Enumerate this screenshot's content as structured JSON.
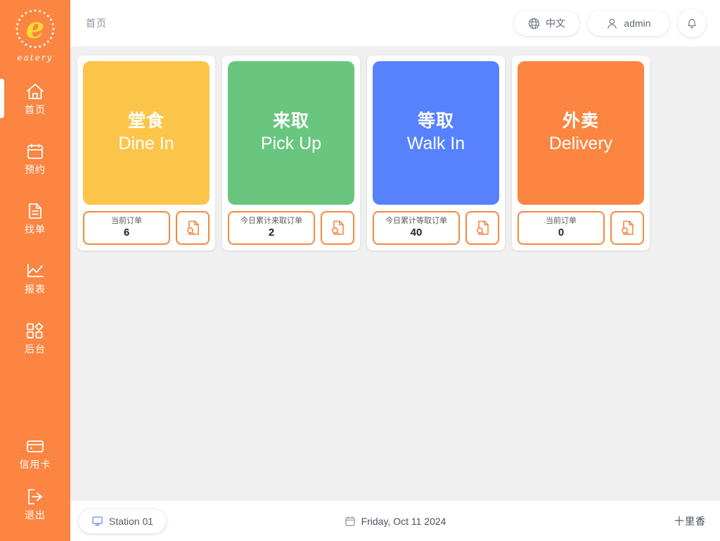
{
  "brand": {
    "logo_letter": "e",
    "logo_word": "eatery",
    "logo_letter_color": "#FBD832",
    "sidebar_color": "#FB8541"
  },
  "sidebar": {
    "items": [
      {
        "label": "首页",
        "icon": "home-icon",
        "active": true
      },
      {
        "label": "预约",
        "icon": "calendar-icon",
        "active": false
      },
      {
        "label": "找单",
        "icon": "document-icon",
        "active": false
      },
      {
        "label": "报表",
        "icon": "chart-line-icon",
        "active": false
      },
      {
        "label": "后台",
        "icon": "dashboard-squares-icon",
        "active": false
      }
    ],
    "bottom_items": [
      {
        "label": "信用卡",
        "icon": "credit-card-icon"
      },
      {
        "label": "退出",
        "icon": "logout-icon"
      }
    ]
  },
  "header": {
    "breadcrumb": "首页",
    "language_label": "中文",
    "language_icon": "globe-icon",
    "user_label": "admin",
    "user_icon": "user-icon",
    "notification_icon": "bell-icon"
  },
  "cards": [
    {
      "zh": "堂食",
      "en": "Dine In",
      "color": "#FBC54A",
      "count_label": "当前订单",
      "count_value": "6",
      "search_icon": "document-search-icon"
    },
    {
      "zh": "来取",
      "en": "Pick Up",
      "color": "#68C67E",
      "count_label": "今日累计来取订单",
      "count_value": "2",
      "search_icon": "document-search-icon"
    },
    {
      "zh": "等取",
      "en": "Walk In",
      "color": "#5682FD",
      "count_label": "今日累计等取订单",
      "count_value": "40",
      "search_icon": "document-search-icon"
    },
    {
      "zh": "外卖",
      "en": "Delivery",
      "color": "#FB8541",
      "count_label": "当前订单",
      "count_value": "0",
      "search_icon": "document-search-icon"
    }
  ],
  "footer": {
    "station_label": "Station 01",
    "station_icon": "monitor-icon",
    "date_text": "Friday, Oct 11 2024",
    "date_icon": "calendar-icon",
    "store_name": "十里香"
  }
}
